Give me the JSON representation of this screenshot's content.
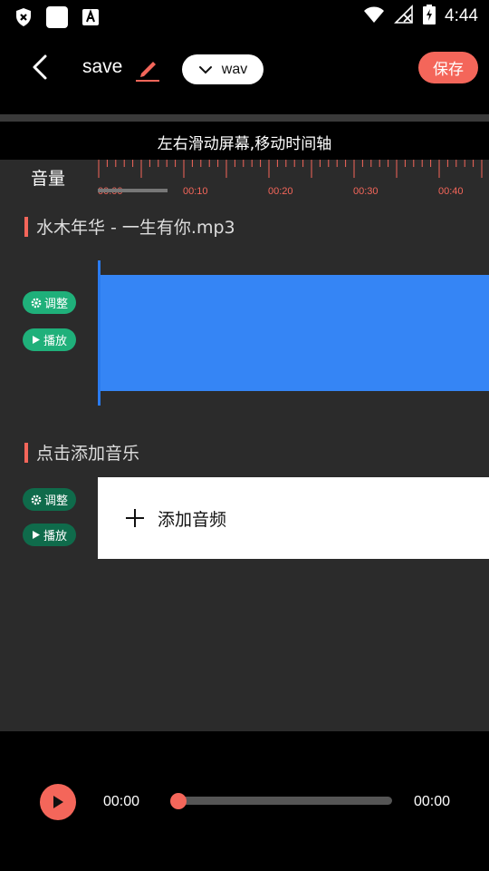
{
  "status": {
    "time": "4:44"
  },
  "header": {
    "title": "save",
    "format": "wav",
    "save_label": "保存"
  },
  "hint": "左右滑动屏幕,移动时间轴",
  "timeline": {
    "volume_label": "音量",
    "ticks": [
      "00:00",
      "00:10",
      "00:20",
      "00:30",
      "00:40"
    ]
  },
  "tracks": [
    {
      "title": "水木年华 - 一生有你.mp3",
      "adjust_label": "调整",
      "play_label": "播放"
    },
    {
      "title": "点击添加音乐",
      "adjust_label": "调整",
      "play_label": "播放",
      "add_label": "添加音频"
    }
  ],
  "player": {
    "current_time": "00:00",
    "total_time": "00:00",
    "progress": 0
  },
  "colors": {
    "accent": "#f4665a",
    "wave": "#3585f5",
    "green": "#1fb07a",
    "green_dark": "#0f6b4b",
    "panel": "#2b2b2b"
  }
}
